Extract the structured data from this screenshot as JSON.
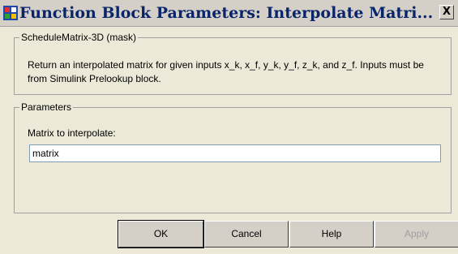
{
  "window": {
    "title": "Function Block Parameters: Interpolate Matri...",
    "close_glyph": "X"
  },
  "mask_group": {
    "title": "ScheduleMatrix-3D (mask)",
    "description": "Return an interpolated matrix for given inputs x_k, x_f, y_k, y_f, z_k, and z_f. Inputs must be from Simulink Prelookup block."
  },
  "parameters_group": {
    "title": "Parameters",
    "matrix_label": "Matrix to interpolate:",
    "matrix_value": "matrix"
  },
  "buttons": {
    "ok": "OK",
    "cancel": "Cancel",
    "help": "Help",
    "apply": "Apply"
  },
  "icons": {
    "app": "simulink-block-icon",
    "close": "close-icon"
  },
  "colors": {
    "title_text": "#0a246a",
    "dialog_bg": "#ece9d8",
    "input_border": "#7f9db9"
  }
}
